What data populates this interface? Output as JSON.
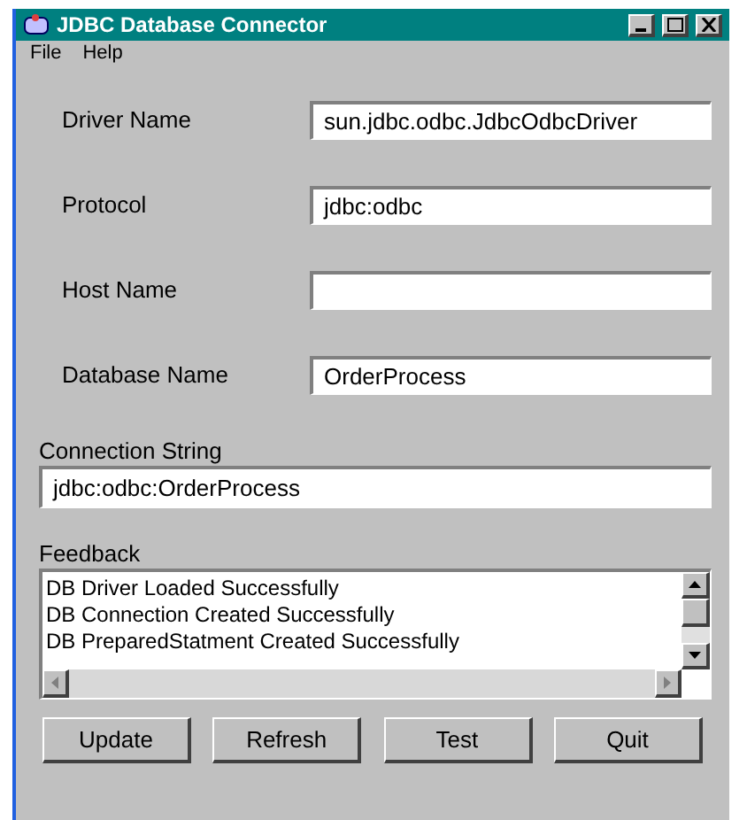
{
  "window": {
    "title": "JDBC Database Connector"
  },
  "menu": [
    "File",
    "Help"
  ],
  "fields": [
    {
      "label": "Driver Name",
      "value": "sun.jdbc.odbc.JdbcOdbcDriver"
    },
    {
      "label": "Protocol",
      "value": "jdbc:odbc"
    },
    {
      "label": "Host Name"
    },
    {
      "label": "Database Name",
      "value": "OrderProcess"
    }
  ],
  "connection_string": {
    "label": "Connection String",
    "value": "jdbc:odbc:OrderProcess"
  },
  "feedback": {
    "label": "Feedback",
    "lines": [
      "DB Driver Loaded Successfully",
      "DB Connection Created Successfully",
      "DB PreparedStatment Created Successfully"
    ]
  },
  "buttons": [
    "Update",
    "Refresh",
    "Test",
    "Quit"
  ]
}
